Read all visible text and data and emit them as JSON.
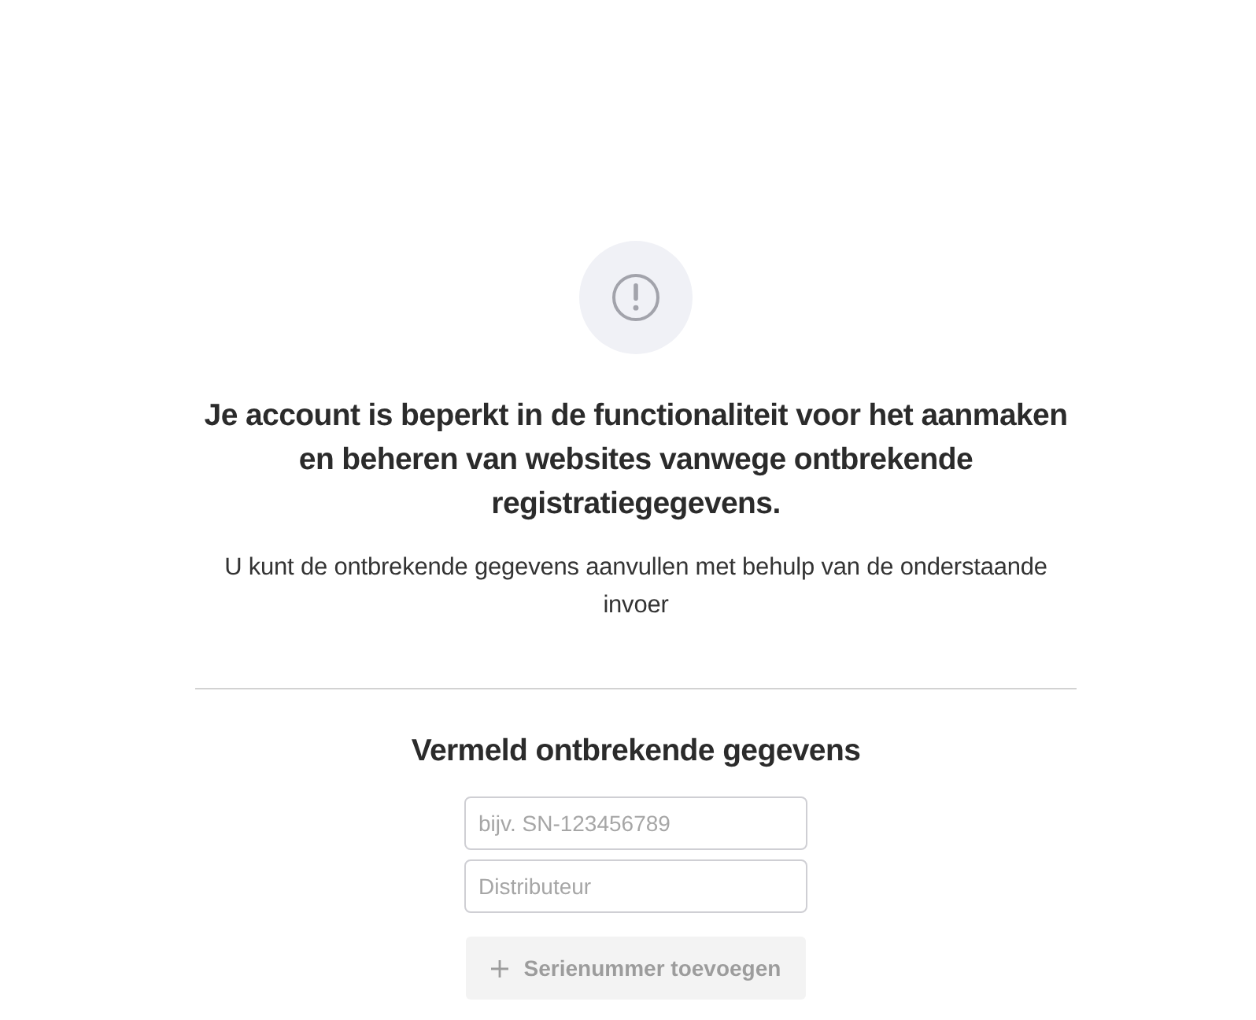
{
  "notice": {
    "title": "Je account is beperkt in de functionaliteit voor het aanmaken en beheren van websites vanwege ontbrekende registratiegegevens.",
    "message": "U kunt de ontbrekende gegevens aanvullen met behulp van de onderstaande invoer"
  },
  "form": {
    "title": "Vermeld ontbrekende gegevens",
    "fields": [
      {
        "placeholder": "bijv. SN-123456789"
      },
      {
        "placeholder": "Distributeur"
      }
    ],
    "add_button": {
      "label": "Serienummer toevoegen",
      "disabled": true
    }
  }
}
